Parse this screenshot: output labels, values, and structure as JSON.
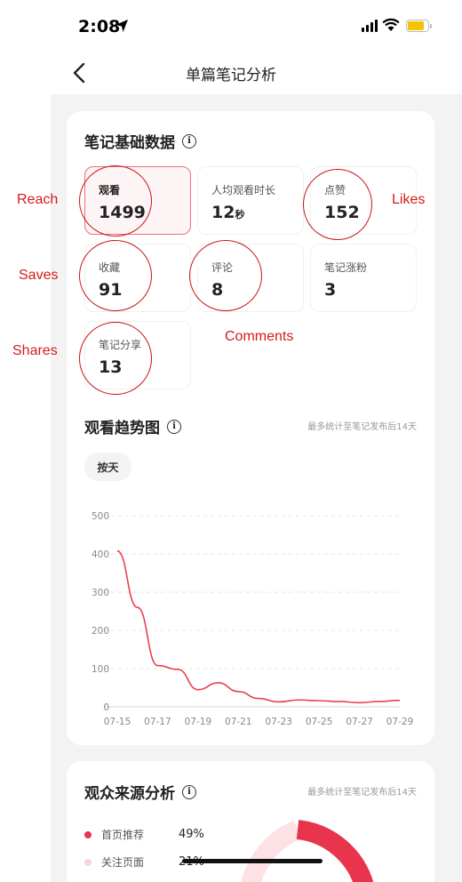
{
  "status_bar": {
    "time": "2:08"
  },
  "nav": {
    "title": "单篇笔记分析"
  },
  "basic_data": {
    "title": "笔记基础数据",
    "metrics": [
      {
        "label": "观看",
        "value": "1499",
        "unit": ""
      },
      {
        "label": "人均观看时长",
        "value": "12",
        "unit": "秒"
      },
      {
        "label": "点赞",
        "value": "152",
        "unit": ""
      },
      {
        "label": "收藏",
        "value": "91",
        "unit": ""
      },
      {
        "label": "评论",
        "value": "8",
        "unit": ""
      },
      {
        "label": "笔记涨粉",
        "value": "3",
        "unit": ""
      },
      {
        "label": "笔记分享",
        "value": "13",
        "unit": ""
      }
    ]
  },
  "trend": {
    "title": "观看趋势图",
    "note": "最多统计至笔记发布后14天",
    "granularity_pill": "按天"
  },
  "chart_data": {
    "type": "line",
    "x": [
      "07-15",
      "07-16",
      "07-17",
      "07-18",
      "07-19",
      "07-20",
      "07-21",
      "07-22",
      "07-23",
      "07-24",
      "07-25",
      "07-26",
      "07-27",
      "07-28",
      "07-29"
    ],
    "x_tick_labels": [
      "07-15",
      "07-17",
      "07-19",
      "07-21",
      "07-23",
      "07-25",
      "07-27",
      "07-29"
    ],
    "series": [
      {
        "values": [
          408,
          260,
          108,
          98,
          45,
          63,
          40,
          22,
          13,
          18,
          16,
          14,
          11,
          14,
          17
        ]
      }
    ],
    "ylim": [
      0,
      500
    ],
    "y_ticks": [
      0,
      100,
      200,
      300,
      400,
      500
    ],
    "xlabel": "",
    "ylabel": "",
    "grid": "horizontal dashed",
    "line_color": "#e8414d"
  },
  "audience": {
    "title": "观众来源分析",
    "note": "最多统计至笔记发布后14天",
    "sources": [
      {
        "label": "首页推荐",
        "pct": "49%",
        "color": "#e8344d"
      },
      {
        "label": "关注页面",
        "pct": "21%",
        "color": "#fbd3d8"
      }
    ]
  },
  "annotations": {
    "reach": "Reach",
    "likes": "Likes",
    "saves": "Saves",
    "shares": "Shares",
    "comments": "Comments"
  },
  "colors": {
    "accent": "#e8344d",
    "annotation": "#d41c1c"
  }
}
